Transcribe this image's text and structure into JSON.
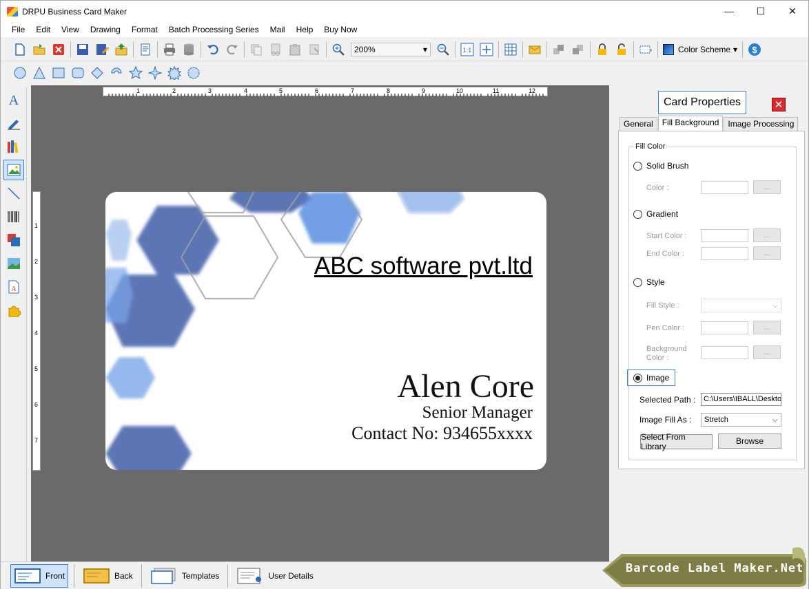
{
  "window": {
    "title": "DRPU Business Card Maker"
  },
  "window_controls": {
    "minimize": "—",
    "maximize": "☐",
    "close": "✕"
  },
  "menu": [
    "File",
    "Edit",
    "View",
    "Drawing",
    "Format",
    "Batch Processing Series",
    "Mail",
    "Help",
    "Buy Now"
  ],
  "toolbar": {
    "zoom": "200%",
    "zoom_arrow": "▾",
    "color_scheme": "Color Scheme",
    "color_scheme_arrow": "▾"
  },
  "ruler": {
    "h_labels": [
      "1",
      "2",
      "3",
      "4",
      "5",
      "6",
      "7",
      "8",
      "9",
      "10",
      "11",
      "12"
    ],
    "v_labels": [
      "1",
      "2",
      "3",
      "4",
      "5",
      "6",
      "7"
    ]
  },
  "card": {
    "company": "ABC software pvt.ltd",
    "name": "Alen Core",
    "position": "Senior Manager",
    "contact": "Contact No: 934655xxxx"
  },
  "props": {
    "title": "Card Properties",
    "close": "✕",
    "tabs": [
      "General",
      "Fill Background",
      "Image Processing"
    ],
    "fill_color": "Fill Color",
    "solid_brush": "Solid Brush",
    "color_label": "Color :",
    "gradient": "Gradient",
    "start_color": "Start Color :",
    "end_color": "End Color :",
    "style": "Style",
    "fill_style": "Fill Style :",
    "pen_color": "Pen Color :",
    "background_color_1": "Background",
    "background_color_2": "Color :",
    "ellipsis": "...",
    "image": "Image",
    "selected_path_label": "Selected Path :",
    "selected_path_value": "C:\\Users\\IBALL\\Deskto",
    "image_fill_as_label": "Image Fill As :",
    "image_fill_as_value": "Stretch",
    "select_arrow": "⌵",
    "select_from_library": "Select From Library",
    "browse": "Browse"
  },
  "bottom": {
    "front": "Front",
    "back": "Back",
    "templates": "Templates",
    "user_details": "User Details"
  },
  "brand": "Barcode Label Maker.Net"
}
